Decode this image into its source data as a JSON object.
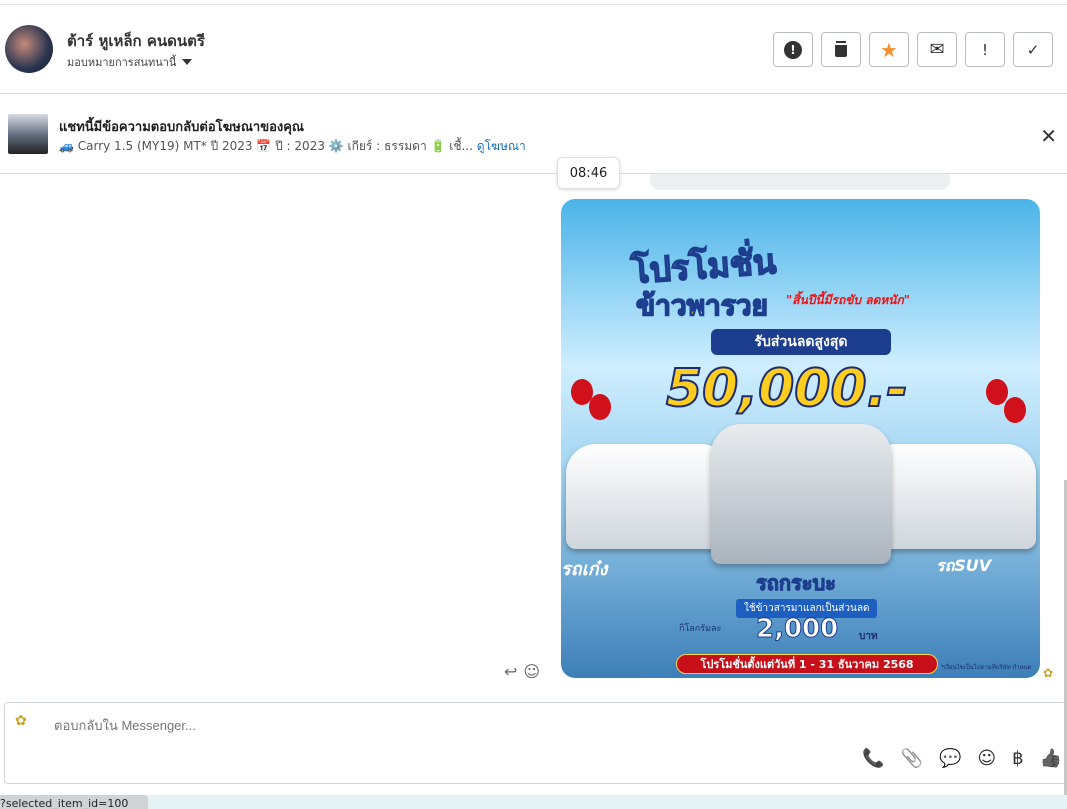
{
  "contact": {
    "name": "ต้าร์ หูเหล็ก คนดนตรี",
    "assign_label": "มอบหมายการสนทนานี้"
  },
  "actions": [
    {
      "name": "report-icon",
      "glyph": "❗"
    },
    {
      "name": "trash-icon",
      "glyph": "🗑"
    },
    {
      "name": "star-icon",
      "glyph": "★"
    },
    {
      "name": "mail-icon",
      "glyph": "✉"
    },
    {
      "name": "important-icon",
      "glyph": "!"
    },
    {
      "name": "done-icon",
      "glyph": "✓"
    }
  ],
  "ad": {
    "title": "แชทนี้มีข้อความตอบกลับต่อโฆษณาของคุณ",
    "subtitle": "🚙 Carry 1.5 (MY19) MT* ปี 2023 📅 ปี : 2023 ⚙️ เกียร์ : ธรรมดา 🔋 เชื้...",
    "link": "ดูโฆษณา",
    "close": "✕"
  },
  "message": {
    "time": "08:46",
    "promo": {
      "line1": "โปรโมชั่น",
      "line2": "ข้าวพารวย",
      "tagline": "\"สิ้นปีนี้มีรถขับ ลดหนัก\"",
      "discount_label": "รับส่วนลดสูงสุด",
      "discount": "50,000.-",
      "left_label": "รถเก๋ง",
      "right_label": "รถSUV",
      "center_label": "รถกระบะ",
      "rice_note": "ใช้ข้าวสารมาแลกเป็นส่วนลด",
      "per_kg": "กิโลกรัมละ",
      "rice_value": "2,000",
      "unit": "บาท",
      "period": "โปรโมชั่นตั้งแต่วันที่ 1 - 31 ธันวาคม 2568",
      "fineprint": "*เงื่อนไขเป็นไปตามที่บริษัท กำหนด"
    }
  },
  "composer": {
    "placeholder": "ตอบกลับใน Messenger...",
    "tools": {
      "call": "📞",
      "attach": "📎",
      "saved_reply": "💬",
      "emoji": "☺",
      "payment": "฿",
      "like": "👍"
    }
  },
  "status": "?selected_item_id=100",
  "colors": {
    "star": "#f5922f",
    "link": "#1b6fb8"
  }
}
